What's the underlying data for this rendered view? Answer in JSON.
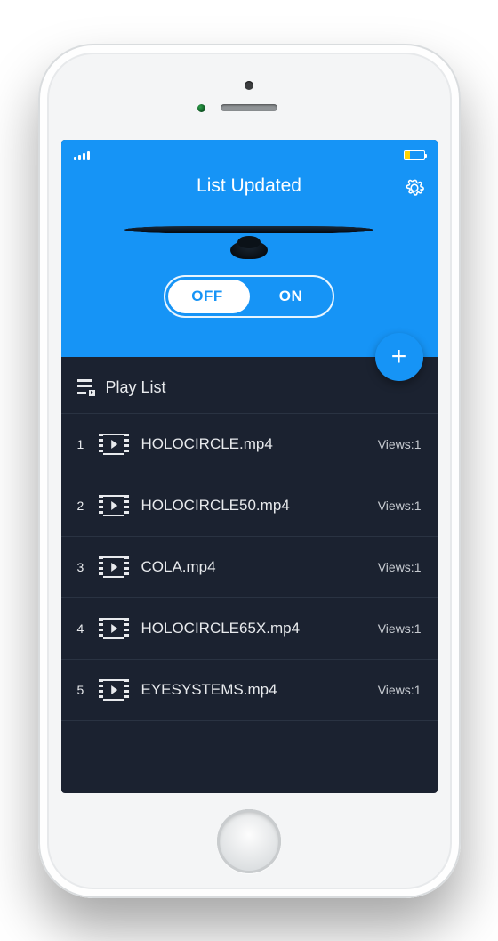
{
  "header": {
    "title": "List Updated"
  },
  "toggle": {
    "off_label": "OFF",
    "on_label": "ON",
    "state": "off"
  },
  "fab": {
    "glyph": "+"
  },
  "playlist": {
    "header_label": "Play List",
    "views_prefix": "Views:",
    "items": [
      {
        "index": "1",
        "name": "HOLOCIRCLE.mp4",
        "views": "1"
      },
      {
        "index": "2",
        "name": "HOLOCIRCLE50.mp4",
        "views": "1"
      },
      {
        "index": "3",
        "name": "COLA.mp4",
        "views": "1"
      },
      {
        "index": "4",
        "name": "HOLOCIRCLE65X.mp4",
        "views": "1"
      },
      {
        "index": "5",
        "name": "EYESYSTEMS.mp4",
        "views": "1"
      }
    ]
  }
}
